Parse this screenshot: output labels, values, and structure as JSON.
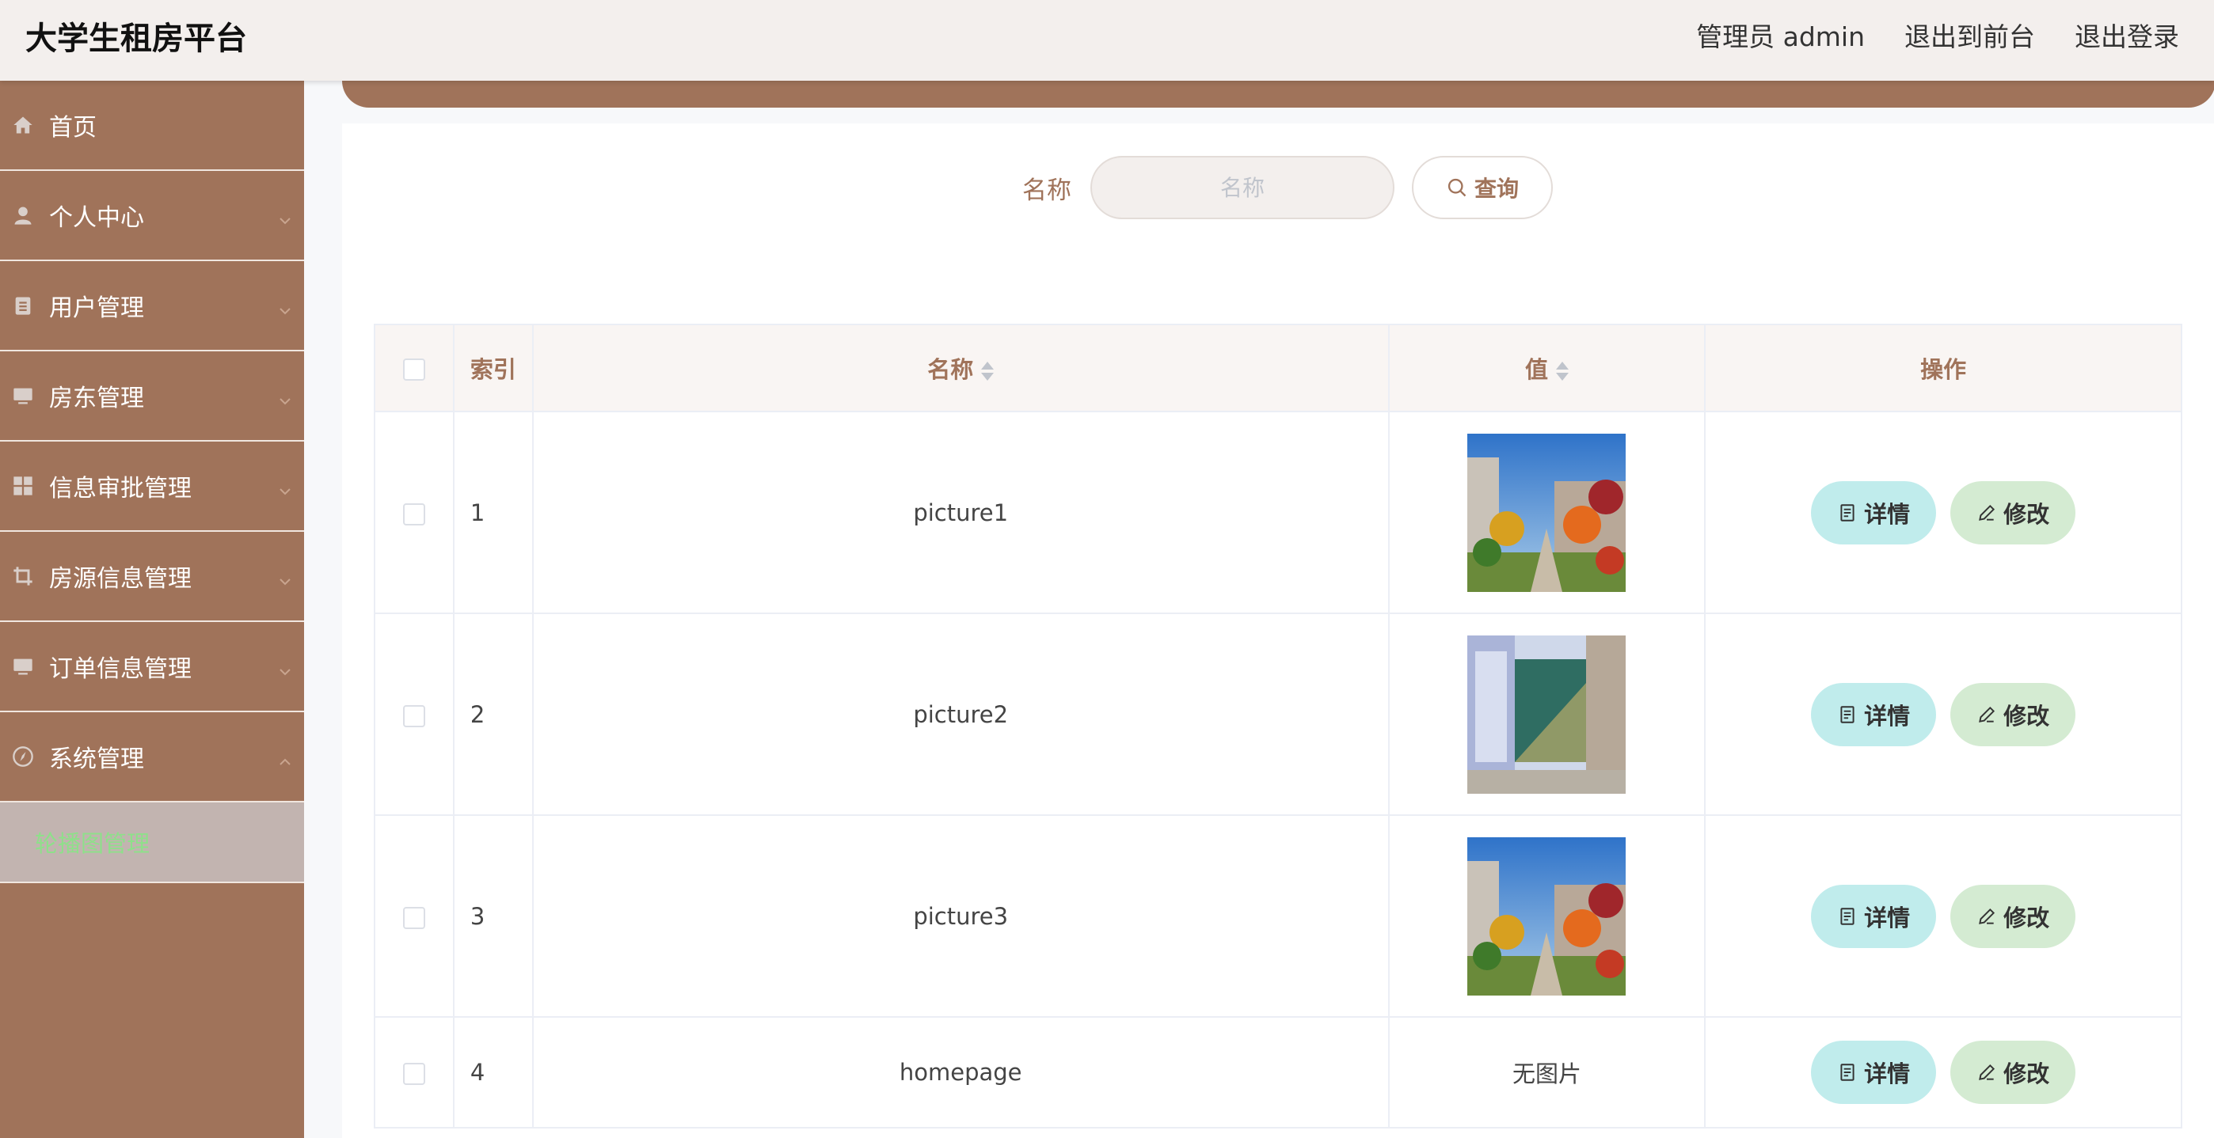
{
  "header": {
    "brand": "大学生租房平台",
    "user": "管理员 admin",
    "to_front": "退出到前台",
    "logout": "退出登录"
  },
  "sidebar": {
    "items": [
      {
        "label": "首页",
        "icon": "home-icon"
      },
      {
        "label": "个人中心",
        "icon": "user-icon"
      },
      {
        "label": "用户管理",
        "icon": "clipboard-icon"
      },
      {
        "label": "房东管理",
        "icon": "monitor-icon"
      },
      {
        "label": "信息审批管理",
        "icon": "grid-icon"
      },
      {
        "label": "房源信息管理",
        "icon": "crop-icon"
      },
      {
        "label": "订单信息管理",
        "icon": "monitor-icon"
      },
      {
        "label": "系统管理",
        "icon": "compass-icon"
      }
    ],
    "submenu": {
      "label": "轮播图管理"
    }
  },
  "search": {
    "label": "名称",
    "placeholder": "名称",
    "value": "",
    "button": "查询"
  },
  "table": {
    "headers": {
      "index": "索引",
      "name": "名称",
      "value": "值",
      "ops": "操作"
    },
    "rows": [
      {
        "index": "1",
        "name": "picture1",
        "value_type": "image",
        "image": "campus-street-thumbnail"
      },
      {
        "index": "2",
        "name": "picture2",
        "value_type": "image",
        "image": "room-interior-thumbnail"
      },
      {
        "index": "3",
        "name": "picture3",
        "value_type": "image",
        "image": "campus-street-thumbnail"
      },
      {
        "index": "4",
        "name": "homepage",
        "value_type": "text",
        "value_text": "无图片"
      }
    ],
    "actions": {
      "detail": "详情",
      "edit": "修改"
    }
  },
  "colors": {
    "accent": "#a0735a",
    "sidebar_bg": "#a0735a",
    "submenu_bg": "#c2b4b0",
    "submenu_text": "#8ee08a",
    "detail_btn": "#c0ecec",
    "edit_btn": "#d4ebd2"
  }
}
